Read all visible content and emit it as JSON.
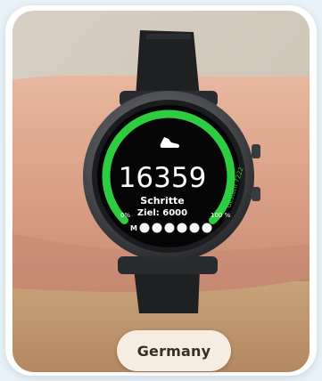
{
  "watch": {
    "steps": "16359",
    "label": "Schritte",
    "goal": "Ziel: 6000",
    "scale_start": "0%",
    "scale_end": "100 %",
    "side_text": "Gestern 7222",
    "progress_fraction": 1.0,
    "accent_color": "#2ecc40",
    "icon": "shoe-icon",
    "history_dots": 6
  },
  "badge": {
    "label": "Germany"
  }
}
